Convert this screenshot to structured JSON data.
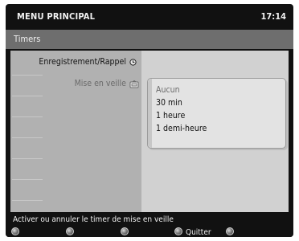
{
  "header": {
    "title": "MENU PRINCIPAL",
    "time": "17:14"
  },
  "section": {
    "title": "Timers"
  },
  "left_menu": [
    {
      "label": "Enregistrement/Rappel",
      "icon": "clock-icon",
      "active": true
    },
    {
      "label": "Mise en veille",
      "icon": "sleep-timer-icon",
      "active": false
    }
  ],
  "submenu": {
    "options": [
      "Aucun",
      "30 min",
      "1 heure",
      "1 demi-heure"
    ],
    "selected_index": 0
  },
  "footer": {
    "help_text": "Activer ou annuler le timer de mise en veille",
    "quit_label": "Quitter"
  },
  "colors": {
    "accent": "#6e6e6e",
    "background": "#111111"
  }
}
